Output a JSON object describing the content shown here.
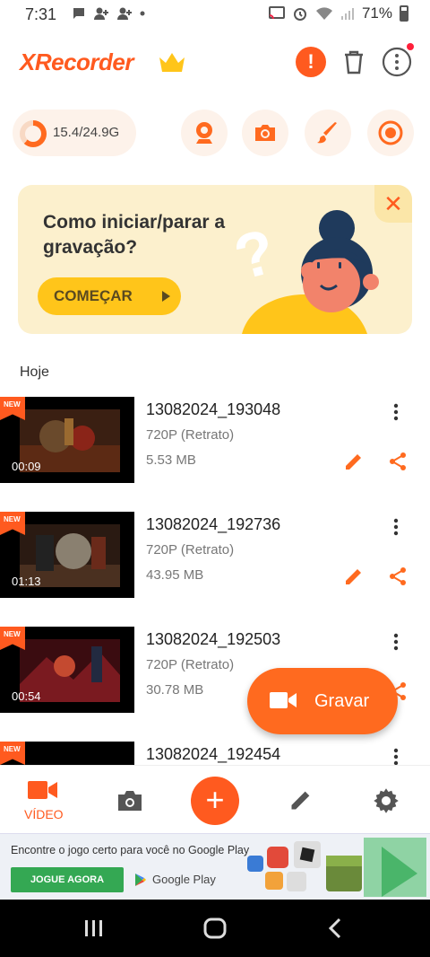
{
  "status_bar": {
    "time": "7:31",
    "battery": "71%"
  },
  "header": {
    "app_name": "XRecorder"
  },
  "storage": {
    "text": "15.4/24.9G",
    "used_fraction": 0.62
  },
  "promo": {
    "title": "Como iniciar/parar a gravação?",
    "button": "COMEÇAR"
  },
  "section": {
    "label": "Hoje"
  },
  "videos": [
    {
      "badge": "NEW",
      "duration": "00:09",
      "title": "13082024_193048",
      "resolution": "720P (Retrato)",
      "size": "5.53 MB"
    },
    {
      "badge": "NEW",
      "duration": "01:13",
      "title": "13082024_192736",
      "resolution": "720P (Retrato)",
      "size": "43.95 MB"
    },
    {
      "badge": "NEW",
      "duration": "00:54",
      "title": "13082024_192503",
      "resolution": "720P (Retrato)",
      "size": "30.78 MB"
    },
    {
      "badge": "NEW",
      "duration": "",
      "title": "13082024_192454",
      "resolution": "",
      "size": ""
    }
  ],
  "record_button": {
    "label": "Gravar"
  },
  "bottom_nav": {
    "video_label": "VÍDEO"
  },
  "ad": {
    "text": "Encontre o jogo certo para você no Google Play",
    "button": "JOGUE AGORA",
    "store": "Google Play"
  },
  "colors": {
    "accent": "#ff5a1f",
    "promo_bg": "#fcf0cd",
    "promo_button": "#ffc51a"
  }
}
